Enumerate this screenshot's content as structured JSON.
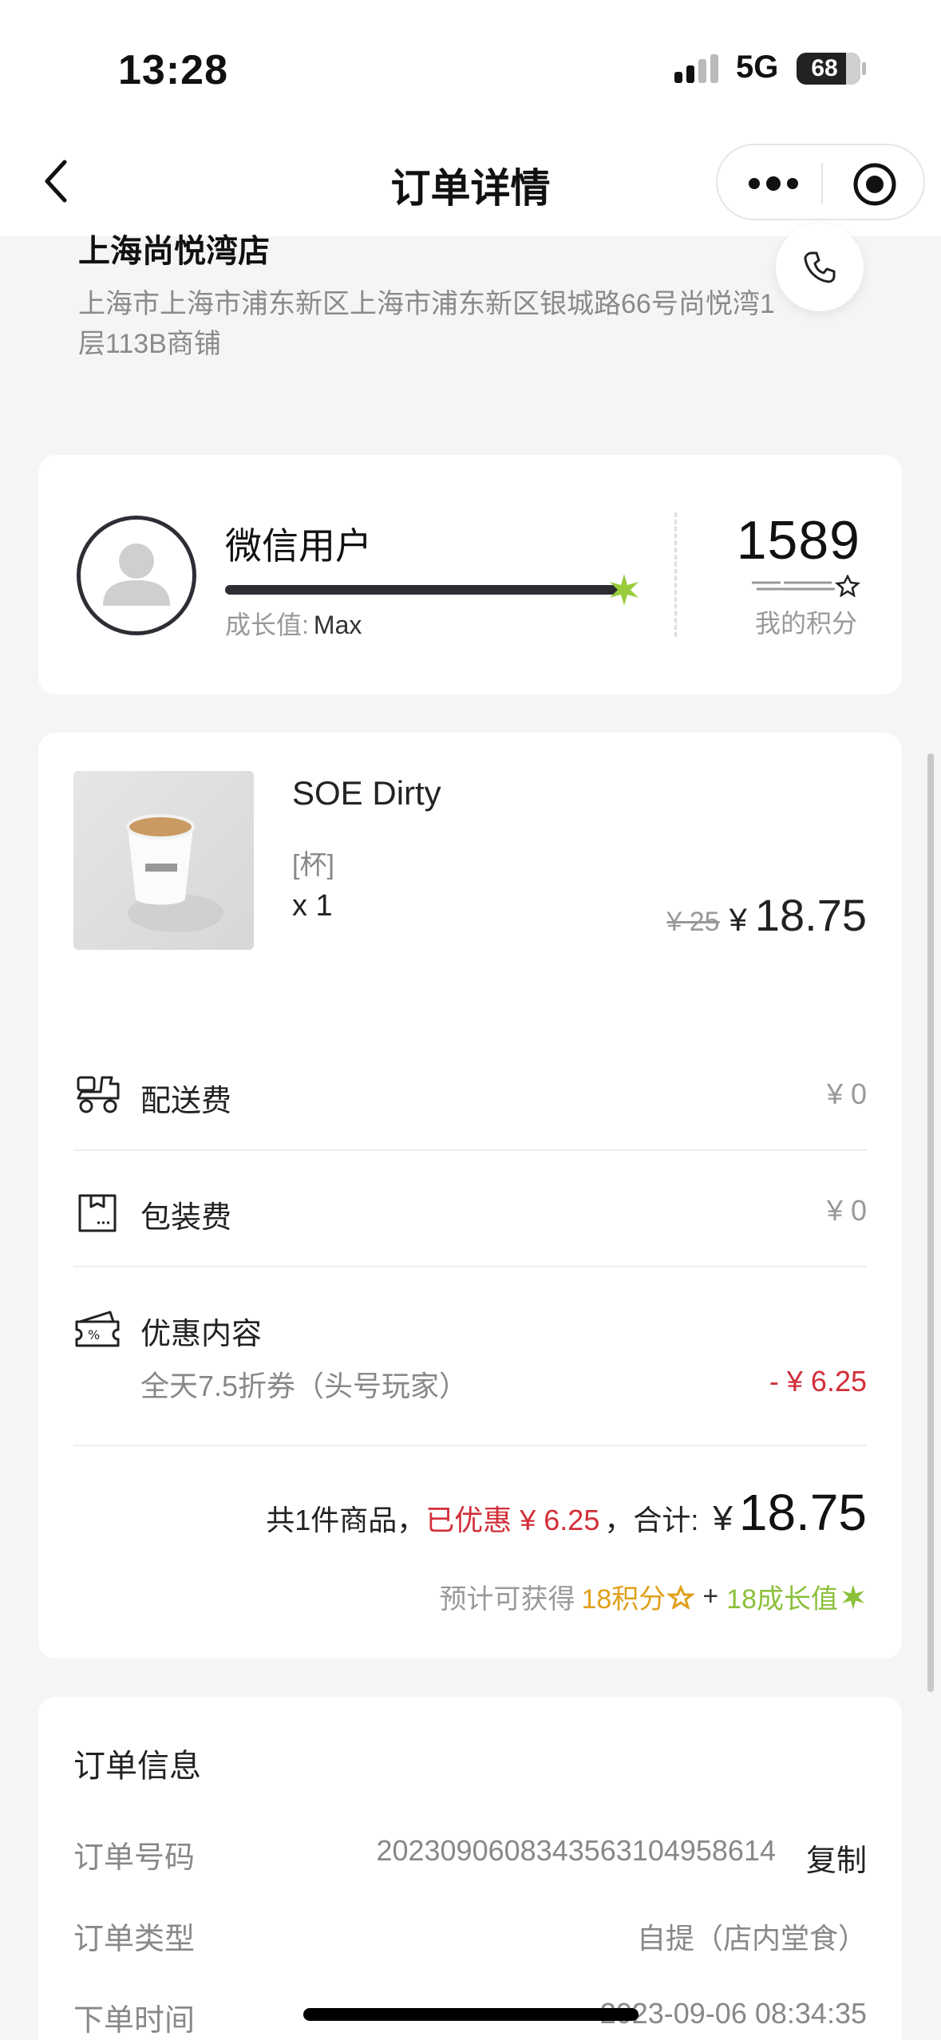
{
  "status_bar": {
    "time": "13:28",
    "network": "5G",
    "battery": "68"
  },
  "nav": {
    "title": "订单详情",
    "back_icon": "chevron-left-icon",
    "more_icon": "more-dots-icon",
    "close_icon": "target-icon"
  },
  "store": {
    "name": "上海尚悦湾店",
    "address": "上海市上海市浦东新区上海市浦东新区银城路66号尚悦湾1层113B商铺",
    "phone_icon": "phone-icon"
  },
  "member": {
    "username": "微信用户",
    "growth_label": "成长值:",
    "growth_value": "Max",
    "growth_progress": 1.0,
    "points": "1589",
    "points_label": "我的积分"
  },
  "product": {
    "name": "SOE Dirty",
    "spec": "[杯]",
    "qty": "x 1",
    "original_price": "¥ 25",
    "price_yen": "¥",
    "price": "18.75"
  },
  "fees": [
    {
      "label": "配送费",
      "amount": "¥ 0",
      "icon": "scooter-icon"
    },
    {
      "label": "包装费",
      "amount": "¥ 0",
      "icon": "package-icon"
    }
  ],
  "discount": {
    "label": "优惠内容",
    "icon": "coupon-icon",
    "item_name": "全天7.5折券（头号玩家）",
    "item_amount": "- ¥ 6.25"
  },
  "summary": {
    "count_text": "共1件商品，",
    "saved_text": "已优惠 ¥ 6.25",
    "total_label": "，合计:",
    "total_yen": "¥",
    "total": "18.75"
  },
  "reward": {
    "prefix": "预计可获得",
    "points_text": "18积分",
    "plus": "+",
    "growth_text": "18成长值"
  },
  "order_info": {
    "title": "订单信息",
    "rows": [
      {
        "key": "订单号码",
        "value": "20230906083435631049586​14"
      },
      {
        "key": "订单类型",
        "value": "自提（店内堂食）"
      },
      {
        "key": "下单时间",
        "value": "2023-09-06 08:34:35"
      }
    ],
    "copy_label": "复制"
  },
  "colors": {
    "accent_red": "#d22f3a",
    "gold": "#e0a01b",
    "green": "#8cc03b",
    "dark": "#2d2d33"
  }
}
